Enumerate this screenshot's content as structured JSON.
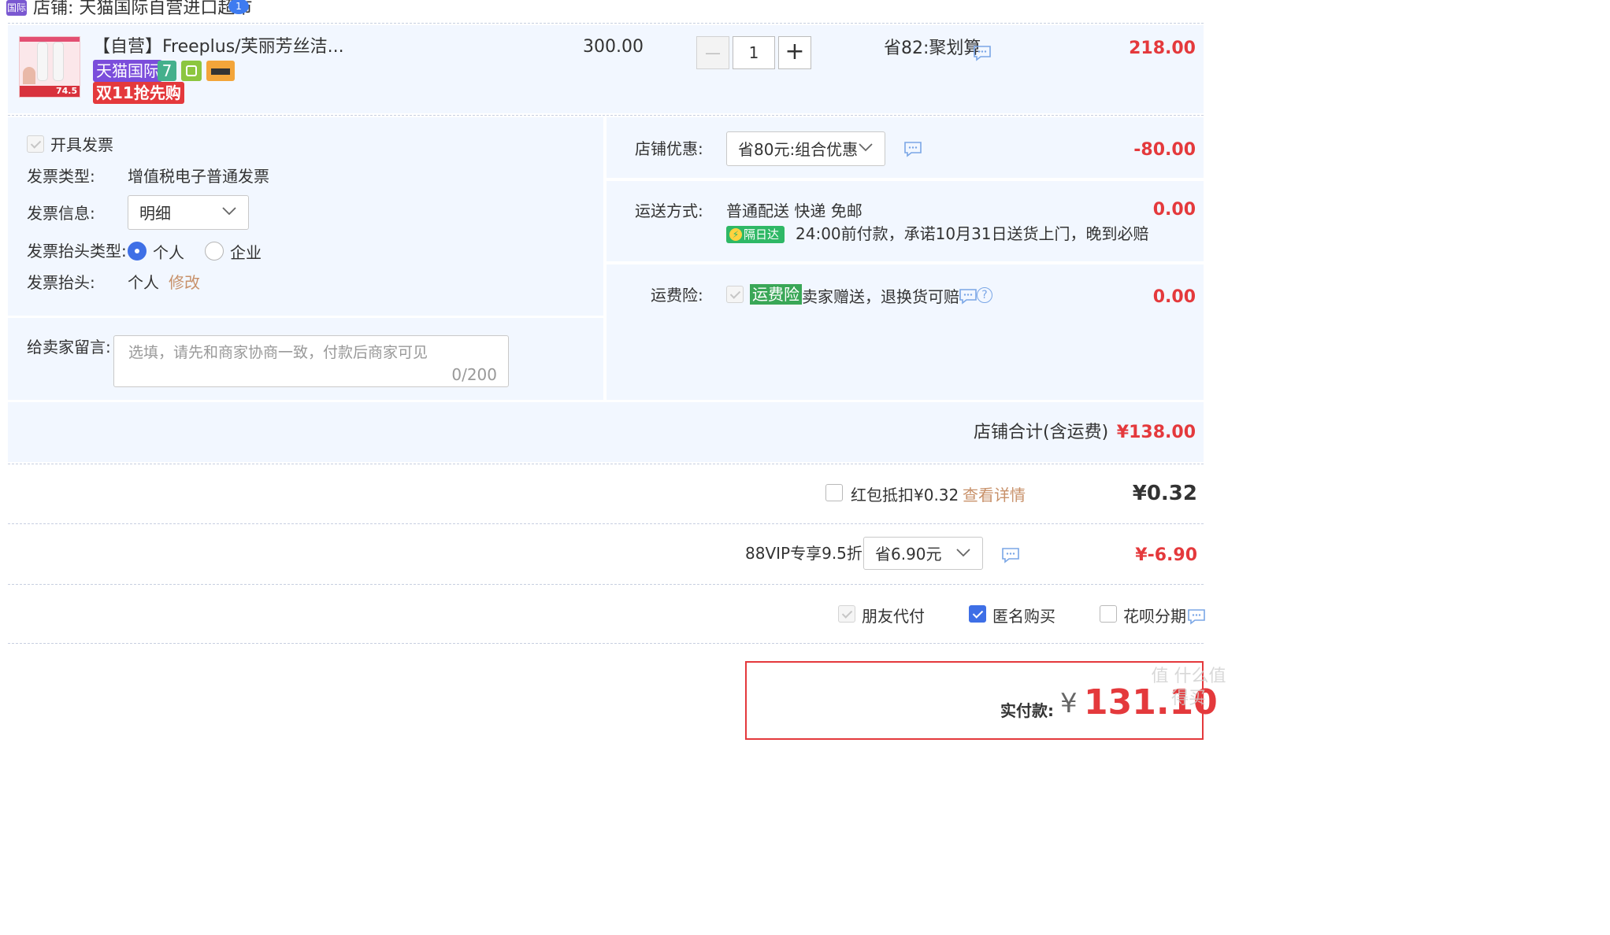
{
  "shop": {
    "badge": "国际",
    "title": "店铺: 天猫国际自营进口超市",
    "bubble": "1"
  },
  "product": {
    "title": "【自营】Freeplus/芙丽芳丝洁...",
    "thumb_price": "74.5",
    "tags": {
      "tmall": "天猫国际",
      "seven": "7",
      "double11": "双11抢先购"
    },
    "unit_price": "300.00",
    "quantity": "1",
    "minus": "—",
    "plus": "+",
    "promo": "省82:聚划算",
    "subtotal": "218.00"
  },
  "invoice": {
    "open_label": "开具发票",
    "type_label": "发票类型:",
    "type_value": "增值税电子普通发票",
    "info_label": "发票信息:",
    "info_value": "明细",
    "title_type_label": "发票抬头类型:",
    "option_personal": "个人",
    "option_company": "企业",
    "title_label": "发票抬头:",
    "title_value": "个人",
    "modify": "修改"
  },
  "message": {
    "label": "给卖家留言:",
    "placeholder": "选填，请先和商家协商一致，付款后商家可见",
    "counter": "0/200"
  },
  "discount": {
    "label": "店铺优惠:",
    "value": "省80元:组合优惠",
    "amount": "-80.00"
  },
  "shipping": {
    "label": "运送方式:",
    "method": "普通配送 快递 免邮",
    "next_day": "隔日达",
    "promise": "24:00前付款，承诺10月31日送货上门，晚到必赔",
    "amount": "0.00"
  },
  "insurance": {
    "label": "运费险:",
    "tag": "运费险",
    "text": "卖家赠送，退换货可赔",
    "amount": "0.00"
  },
  "shop_total": {
    "label": "店铺合计(含运费)",
    "amount": "¥138.00"
  },
  "redpacket": {
    "label": "红包抵扣¥0.32",
    "link": "查看详情",
    "amount": "¥0.32"
  },
  "vip": {
    "label": "88VIP专享9.5折",
    "value": "省6.90元",
    "amount": "¥-6.90"
  },
  "options": {
    "friend_pay": "朋友代付",
    "anonymous": "匿名购买",
    "huabei": "花呗分期"
  },
  "payment": {
    "label": "实付款:",
    "currency": "¥",
    "amount": "131.10"
  },
  "watermark": "值 什么值得买",
  "colors": {
    "accent_red": "#e4393c",
    "accent_blue": "#3e6fe6",
    "panel_bg": "#f2f7ff",
    "link_orange": "#c8916a"
  }
}
